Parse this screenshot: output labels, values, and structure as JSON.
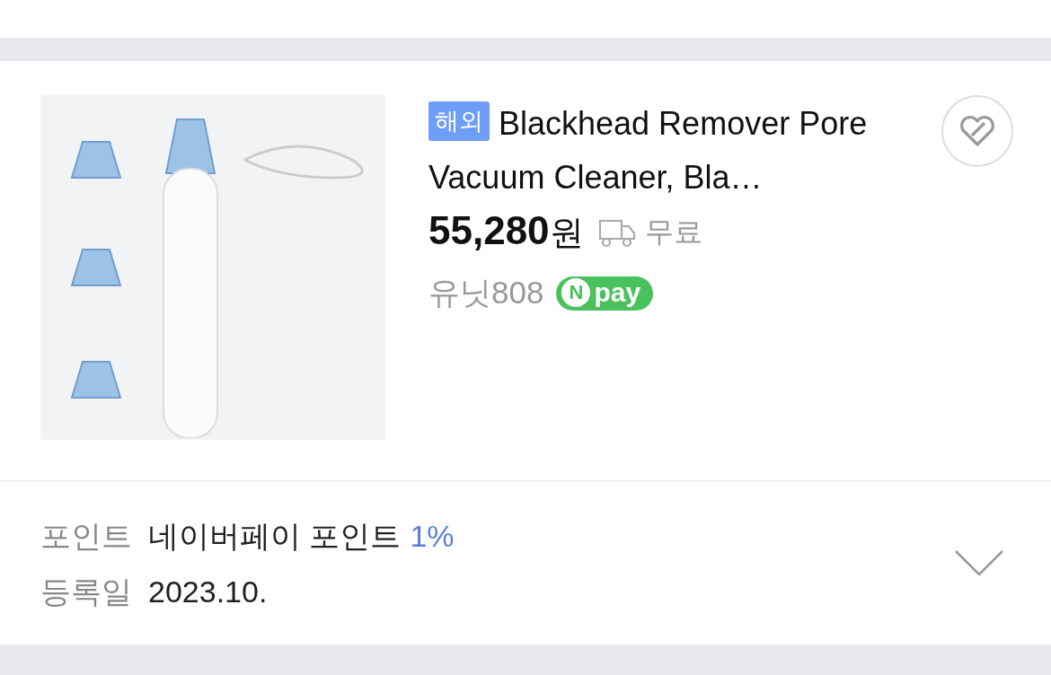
{
  "product": {
    "badge": "해외",
    "title": "Blackhead Remover Pore Vacuum Cleaner, Bla…",
    "price": "55,280",
    "currency": "원",
    "shipping": "무료",
    "seller": "유닛808",
    "npay": {
      "mark": "N",
      "label": "pay"
    },
    "favorited": false
  },
  "details": [
    {
      "label": "포인트",
      "value": "네이버페이 포인트",
      "highlight": "1%"
    },
    {
      "label": "등록일",
      "value": "2023.10."
    }
  ],
  "expanded": false
}
